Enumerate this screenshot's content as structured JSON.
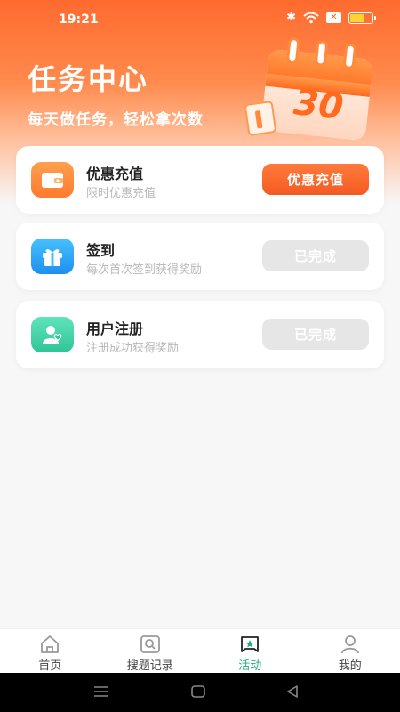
{
  "status": {
    "time": "19:21",
    "battery_level": 0.7
  },
  "header": {
    "title": "任务中心",
    "subtitle": "每天做任务，轻松拿次数",
    "calendar_number": "30"
  },
  "tasks": [
    {
      "title": "优惠充值",
      "desc": "限时优惠充值",
      "button": "优惠充值",
      "state": "active",
      "icon": "wallet-icon",
      "color": "#ff8a3d"
    },
    {
      "title": "签到",
      "desc": "每次首次签到获得奖励",
      "button": "已完成",
      "state": "done",
      "icon": "gift-icon",
      "color": "#2aa6f5"
    },
    {
      "title": "用户注册",
      "desc": "注册成功获得奖励",
      "button": "已完成",
      "state": "done",
      "icon": "user-heart-icon",
      "color": "#3fd3a6"
    }
  ],
  "tabbar": {
    "items": [
      {
        "label": "首页",
        "icon": "home-icon"
      },
      {
        "label": "搜题记录",
        "icon": "search-history-icon"
      },
      {
        "label": "活动",
        "icon": "activity-icon",
        "active": true
      },
      {
        "label": "我的",
        "icon": "profile-icon"
      }
    ]
  },
  "colors": {
    "accent": "#ff6a2e",
    "tab_active": "#1fae7e"
  }
}
